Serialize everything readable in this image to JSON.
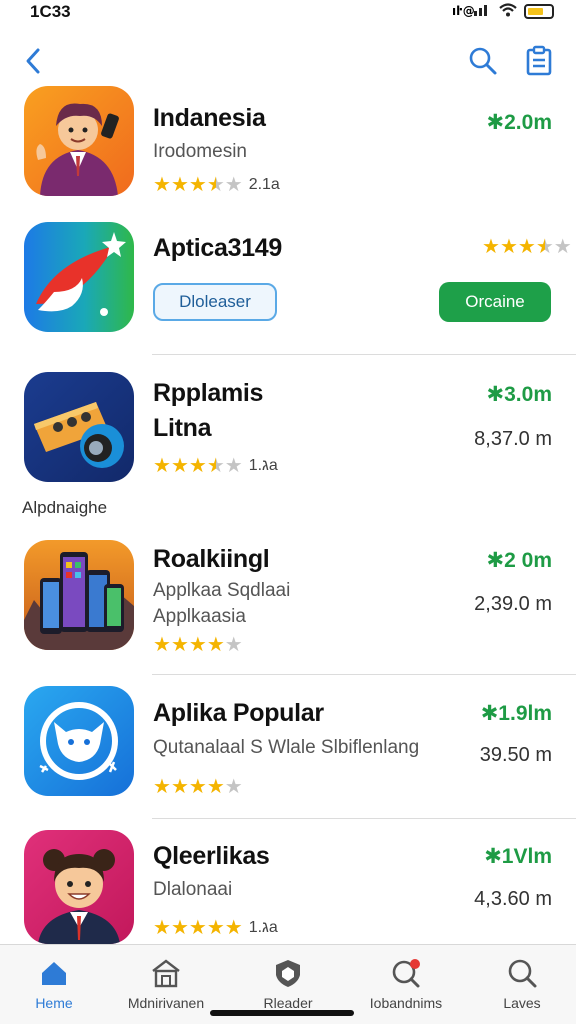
{
  "status_bar": {
    "time": "1C33",
    "network": "ıl",
    "battery_fill": 0.7
  },
  "nav": {
    "back_icon": "chevron-left-icon",
    "search_icon": "search-icon",
    "list_icon": "clipboard-icon"
  },
  "apps": [
    {
      "name": "Indanesia",
      "subtitle": "Irodomesin",
      "rating": 3.5,
      "rating_text": "2.1a",
      "price": "✱2.0m"
    },
    {
      "name": "Aptica3149",
      "rating": 3.5,
      "button_outline": "Dloleaser",
      "button_primary": "Orcaine"
    },
    {
      "name": "Rpplamis",
      "name_line2": "Litna",
      "rating": 3.5,
      "rating_text": "ג.1a",
      "price": "✱3.0m",
      "size": "8,37.0 m"
    },
    {
      "name": "Roalkiingl",
      "subtitle": "Applkaa Sqdlaai",
      "subtitle2": "Applkaasia",
      "rating": 4,
      "price": "✱2 0m",
      "size": "2,39.0 m"
    },
    {
      "name": "Aplika Popular",
      "subtitle": "Qutanalaal S Wlale Slbiflenlang",
      "rating": 4,
      "price": "✱1.9lm",
      "size": "39.50 m"
    },
    {
      "name": "Qleerlikas",
      "subtitle": "Dlalonaai",
      "rating": 5,
      "rating_text": "ג.1a",
      "price": "✱1Vlm",
      "size": "4,3.60 m"
    }
  ],
  "section_label": "Alpdnaighe",
  "tabs": [
    {
      "label": "Heme",
      "icon": "home-icon",
      "active": true
    },
    {
      "label": "Mdnirivanen",
      "icon": "store-icon",
      "active": false
    },
    {
      "label": "Rleader",
      "icon": "shield-icon",
      "active": false
    },
    {
      "label": "Iobandnims",
      "icon": "notification-search-icon",
      "active": false
    },
    {
      "label": "Laves",
      "icon": "search-icon",
      "active": false
    }
  ],
  "colors": {
    "accent": "#2e7bd6",
    "price_green": "#1e9b45",
    "star": "#f4b400",
    "primary_button": "#1ea049"
  }
}
